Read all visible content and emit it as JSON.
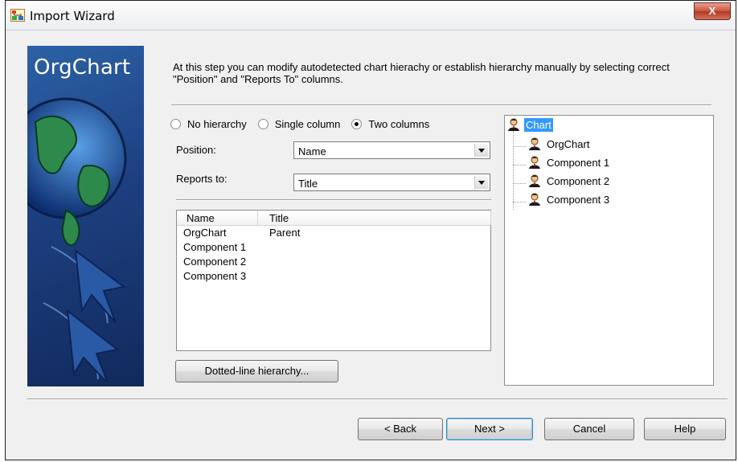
{
  "window": {
    "title": "Import Wizard",
    "close_label": "X"
  },
  "banner": {
    "title": "OrgChart"
  },
  "instruction": "At this step you can modify autodetected chart hierachy or establish hierarchy manually by selecting correct \"Position\" and \"Reports To\" columns.",
  "hierarchy_modes": [
    {
      "label": "No hierarchy",
      "selected": false
    },
    {
      "label": "Single column",
      "selected": false
    },
    {
      "label": "Two columns",
      "selected": true
    }
  ],
  "position": {
    "label": "Position:",
    "value": "Name"
  },
  "reports_to": {
    "label": "Reports to:",
    "value": "Title"
  },
  "table": {
    "columns": [
      "Name",
      "Title"
    ],
    "rows": [
      [
        "OrgChart",
        "Parent"
      ],
      [
        "Component 1",
        ""
      ],
      [
        "Component 2",
        ""
      ],
      [
        "Component 3",
        ""
      ]
    ]
  },
  "dotted_button": "Dotted-line hierarchy...",
  "tree": {
    "root": {
      "label": "Chart",
      "selected": true
    },
    "children": [
      "OrgChart",
      "Component 1",
      "Component 2",
      "Component 3"
    ]
  },
  "footer": {
    "back": "< Back",
    "next": "Next >",
    "cancel": "Cancel",
    "help": "Help"
  },
  "colors": {
    "selection": "#3399ff",
    "banner": "#1d3f80",
    "close": "#c5553e"
  }
}
